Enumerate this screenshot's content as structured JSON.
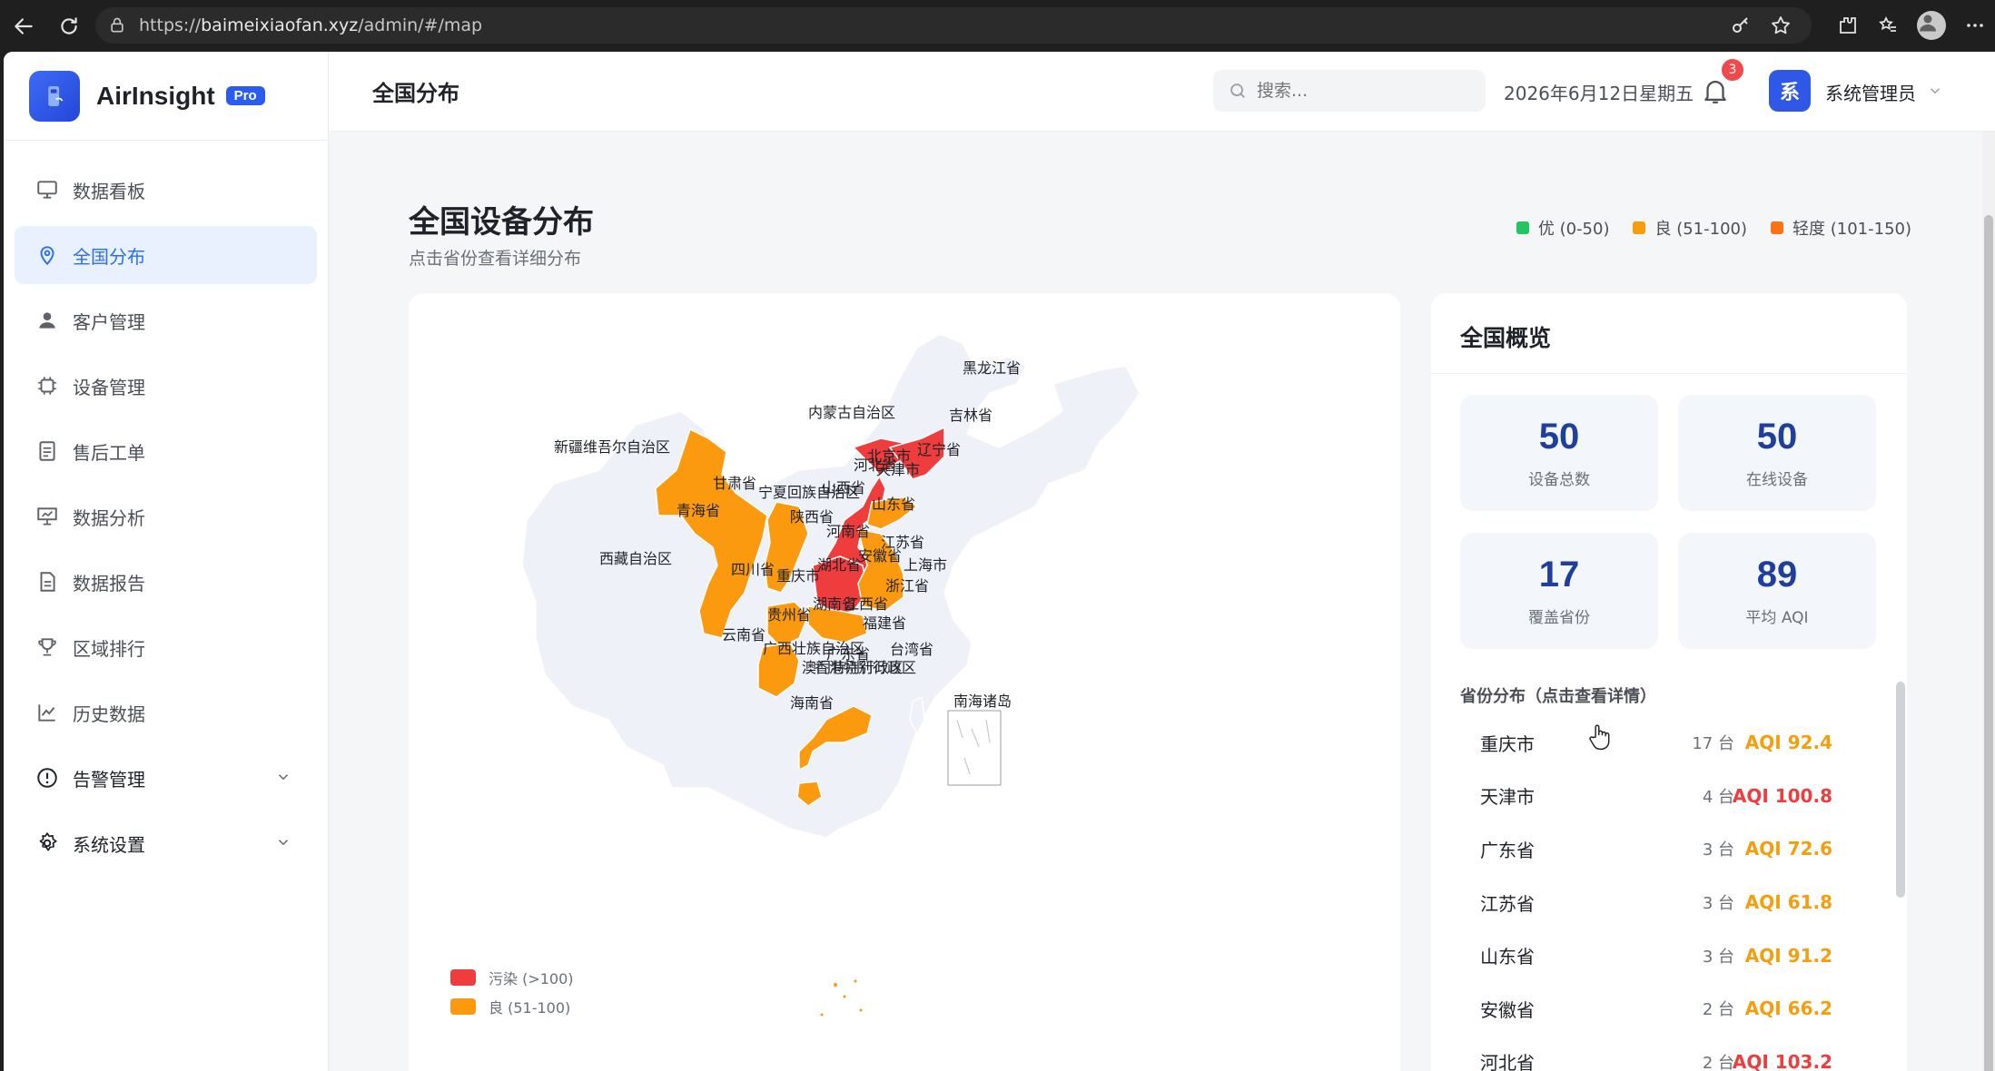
{
  "browser": {
    "url_scheme": "https://",
    "url_host": "baimeixiaofan.xyz",
    "url_path": "/admin/#/map"
  },
  "brand": {
    "name": "AirInsight",
    "badge": "Pro"
  },
  "sidebar": {
    "items": [
      {
        "label": "数据看板",
        "icon": "monitor-icon"
      },
      {
        "label": "全国分布",
        "icon": "map-pin-icon",
        "active": true
      },
      {
        "label": "客户管理",
        "icon": "user-icon"
      },
      {
        "label": "设备管理",
        "icon": "chip-icon"
      },
      {
        "label": "售后工单",
        "icon": "document-icon"
      },
      {
        "label": "数据分析",
        "icon": "presentation-icon"
      },
      {
        "label": "数据报告",
        "icon": "report-icon"
      },
      {
        "label": "区域排行",
        "icon": "trophy-icon"
      },
      {
        "label": "历史数据",
        "icon": "chart-icon"
      },
      {
        "label": "告警管理",
        "icon": "alert-icon"
      },
      {
        "label": "系统设置",
        "icon": "gear-icon"
      }
    ]
  },
  "topbar": {
    "title": "全国分布",
    "search_placeholder": "搜索...",
    "date": "2026年6月12日星期五",
    "notifications": "3",
    "avatar_char": "系",
    "user_name": "系统管理员"
  },
  "page": {
    "heading": "全国设备分布",
    "subheading": "点击省份查看详细分布",
    "legend": [
      {
        "label": "优 (0-50)",
        "color": "#22c55e"
      },
      {
        "label": "良 (51-100)",
        "color": "#f59e0b"
      },
      {
        "label": "轻度 (101-150)",
        "color": "#f97316"
      }
    ]
  },
  "map": {
    "colors": {
      "base": "#eef1f8",
      "good": "#fb9a0e",
      "polluted": "#ef3d3d",
      "border": "#ffffff"
    },
    "legend": [
      {
        "label": "污染 (>100)",
        "color": "#ef3d3d"
      },
      {
        "label": "良 (51-100)",
        "color": "#fb9a0e"
      }
    ],
    "labels": [
      "黑龙江省",
      "吉林省",
      "辽宁省",
      "内蒙古自治区",
      "北京市",
      "河北省",
      "天津市",
      "新疆维吾尔自治区",
      "甘肃省",
      "宁夏回族自治区",
      "山西省",
      "山东省",
      "青海省",
      "陕西省",
      "河南省",
      "江苏省",
      "安徽省",
      "上海市",
      "西藏自治区",
      "四川省",
      "重庆市",
      "湖北省",
      "浙江省",
      "贵州省",
      "湖南省",
      "江西省",
      "福建省",
      "云南省",
      "广西壮族自治区",
      "广东省",
      "台湾省",
      "澳门特别行政区",
      "香港特别行政区",
      "海南省",
      "南海诸岛"
    ]
  },
  "overview": {
    "title": "全国概览",
    "stats": [
      {
        "value": "50",
        "label": "设备总数"
      },
      {
        "value": "50",
        "label": "在线设备"
      },
      {
        "value": "17",
        "label": "覆盖省份"
      },
      {
        "value": "89",
        "label": "平均 AQI"
      }
    ],
    "section_title": "省份分布（点击查看详情）",
    "provinces": [
      {
        "name": "重庆市",
        "count": "17 台",
        "aqi": "AQI 92.4",
        "color": "#f59e0b"
      },
      {
        "name": "天津市",
        "count": "4 台",
        "aqi": "AQI 100.8",
        "color": "#ef3d3d"
      },
      {
        "name": "广东省",
        "count": "3 台",
        "aqi": "AQI 72.6",
        "color": "#f59e0b"
      },
      {
        "name": "江苏省",
        "count": "3 台",
        "aqi": "AQI 61.8",
        "color": "#f59e0b"
      },
      {
        "name": "山东省",
        "count": "3 台",
        "aqi": "AQI 91.2",
        "color": "#f59e0b"
      },
      {
        "name": "安徽省",
        "count": "2 台",
        "aqi": "AQI 66.2",
        "color": "#f59e0b"
      },
      {
        "name": "河北省",
        "count": "2 台",
        "aqi": "AQI 103.2",
        "color": "#ef3d3d"
      }
    ]
  }
}
